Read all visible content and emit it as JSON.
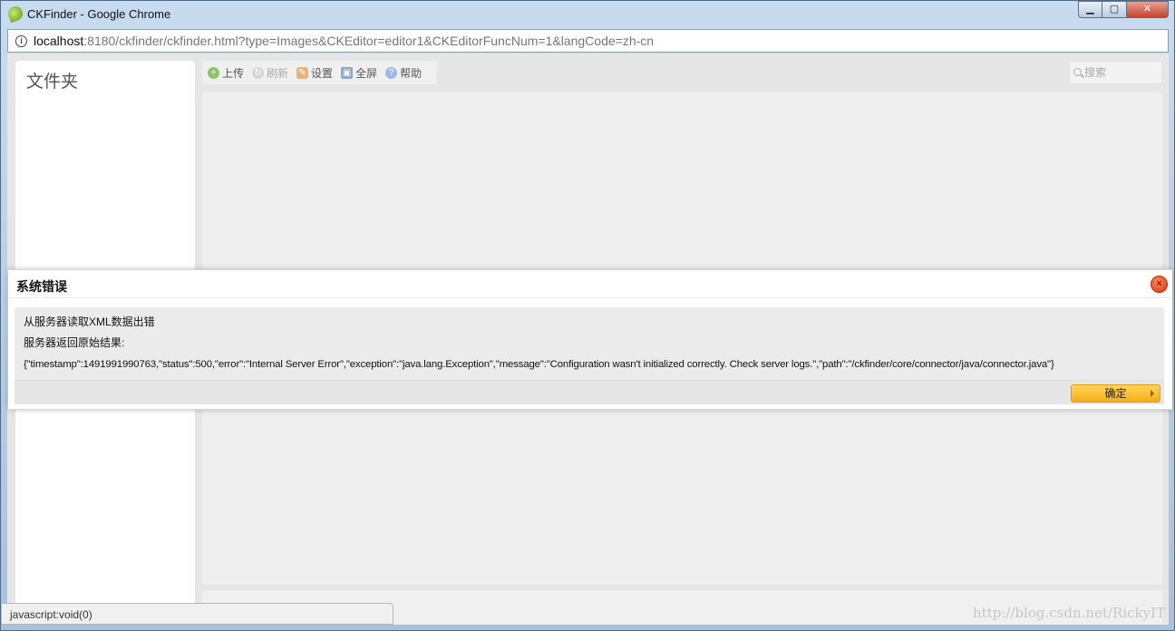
{
  "window": {
    "title": "CKFinder - Google Chrome",
    "url_host": "localhost",
    "url_rest": ":8180/ckfinder/ckfinder.html?type=Images&CKEditor=editor1&CKEditorFuncNum=1&langCode=zh-cn",
    "controls": {
      "minimize": "▁",
      "maximize": "▢",
      "close": "✕"
    }
  },
  "folder_pane": {
    "title": "文件夹"
  },
  "toolbar": {
    "items": [
      {
        "label": "上传",
        "icon": "upload-icon",
        "symbol": "+"
      },
      {
        "label": "刷新",
        "icon": "refresh-icon",
        "symbol": "↻"
      },
      {
        "label": "设置",
        "icon": "settings-icon",
        "symbol": "✎"
      },
      {
        "label": "全屏",
        "icon": "fullscreen-icon",
        "symbol": "▣"
      },
      {
        "label": "帮助",
        "icon": "help-icon",
        "symbol": "?"
      }
    ]
  },
  "search": {
    "placeholder": "搜索"
  },
  "dialog": {
    "title": "系统错误",
    "close_symbol": "×",
    "line1": "从服务器读取XML数据出错",
    "line2": "服务器返回原始结果:",
    "raw_result": "{\"timestamp\":1491991990763,\"status\":500,\"error\":\"Internal Server Error\",\"exception\":\"java.lang.Exception\",\"message\":\"Configuration wasn't initialized correctly. Check server logs.\",\"path\":\"/ckfinder/core/connector/java/connector.java\"}",
    "ok_label": "确定"
  },
  "status": {
    "text": "javascript:void(0)"
  },
  "watermark": "http://blog.csdn.net/RickyIT",
  "colors": {
    "accent": "#f6ad14",
    "close": "#e0300a",
    "chrome": "#a8c2dd"
  }
}
